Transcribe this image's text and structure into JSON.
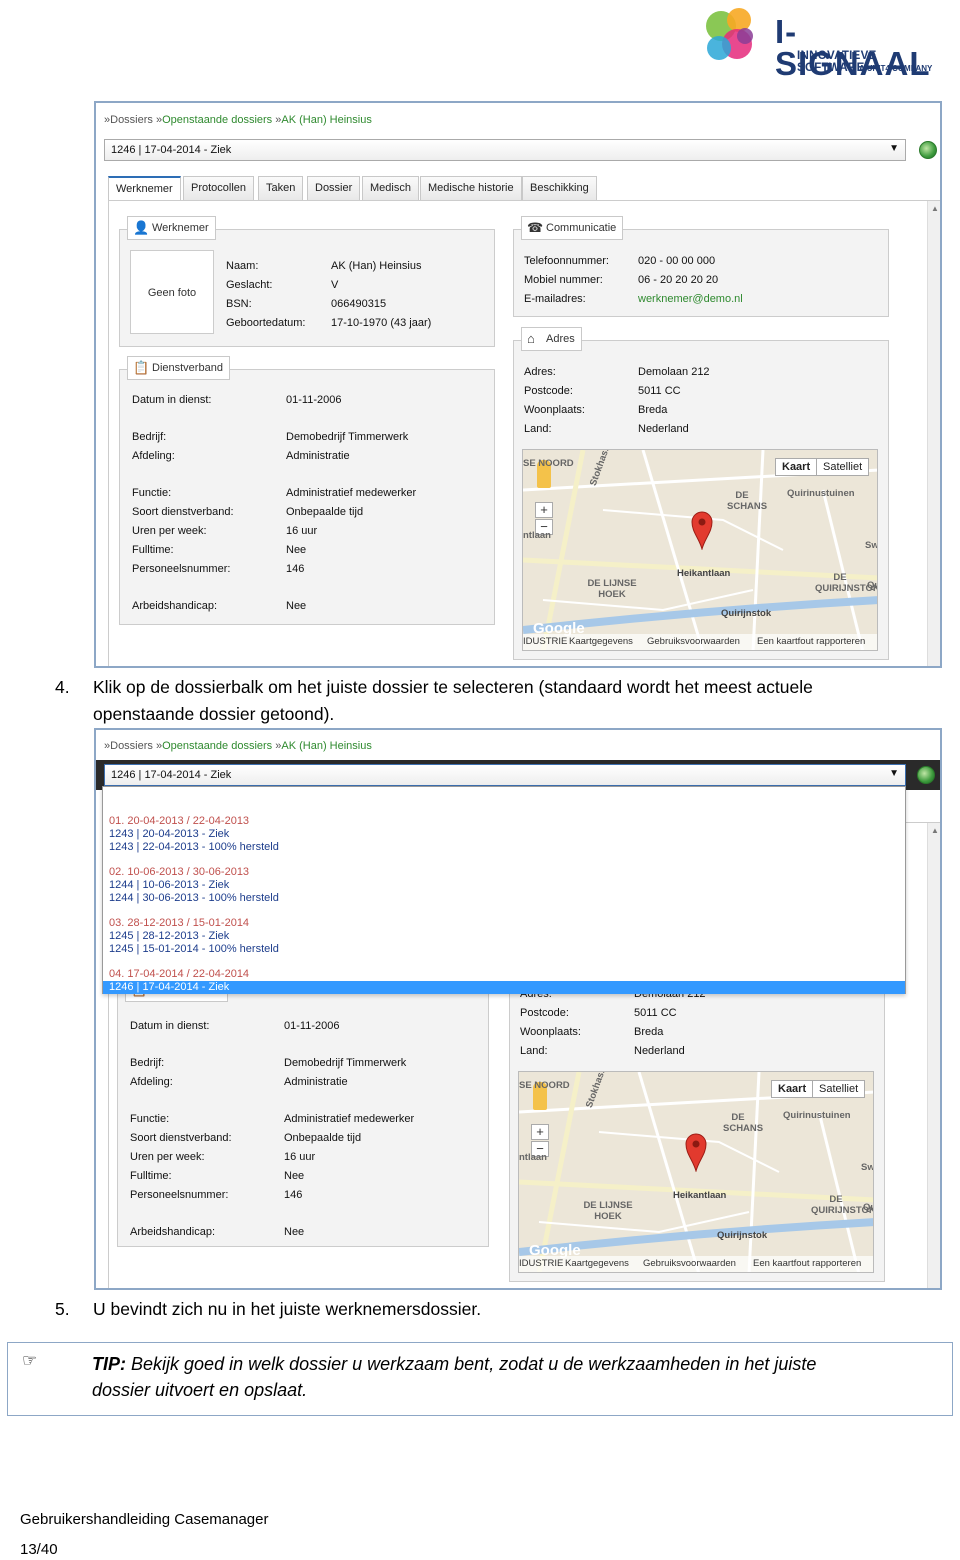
{
  "logo": {
    "name": "I-SIGNAAL",
    "tagline": "INNOVATIEVE SOFTWARE",
    "company": "A UNIT4 COMPANY"
  },
  "app": {
    "breadcrumb": [
      "Dossiers",
      "Openstaande dossiers",
      "AK (Han) Heinsius"
    ],
    "breadcrumb_sep": "»",
    "dossier_select": "1246 | 17-04-2014 - Ziek",
    "tabs": [
      "Werknemer",
      "Protocollen",
      "Taken",
      "Dossier",
      "Medisch",
      "Medische historie",
      "Beschikking"
    ],
    "werknemer": {
      "title": "Werknemer",
      "photo": "Geen foto",
      "labels": [
        "Naam:",
        "Geslacht:",
        "BSN:",
        "Geboortedatum:"
      ],
      "values": [
        "AK (Han) Heinsius",
        "V",
        "066490315",
        "17-10-1970 (43 jaar)"
      ]
    },
    "communicatie": {
      "title": "Communicatie",
      "labels": [
        "Telefoonnummer:",
        "Mobiel nummer:",
        "E-mailadres:"
      ],
      "values": [
        "020 - 00 00 000",
        "06 - 20 20 20 20",
        "werknemer@demo.nl"
      ]
    },
    "dienstverband": {
      "title": "Dienstverband",
      "labels": [
        "Datum in dienst:",
        "Bedrijf:",
        "Afdeling:",
        "Functie:",
        "Soort dienstverband:",
        "Uren per week:",
        "Fulltime:",
        "Personeelsnummer:",
        "Arbeidshandicap:"
      ],
      "values": [
        "01-11-2006",
        "Demobedrijf Timmerwerk",
        "Administratie",
        "Administratief medewerker",
        "Onbepaalde tijd",
        "16 uur",
        "Nee",
        "146",
        "Nee"
      ]
    },
    "adres": {
      "title": "Adres",
      "labels": [
        "Adres:",
        "Postcode:",
        "Woonplaats:",
        "Land:"
      ],
      "values": [
        "Demolaan 212",
        "5011 CC",
        "Breda",
        "Nederland"
      ]
    },
    "map": {
      "buttons": [
        "Kaart",
        "Satelliet"
      ],
      "zoom": [
        "+",
        "−"
      ],
      "labels": [
        "SE NOORD",
        "DE SCHANS",
        "Quirinustuinen",
        "Stokhasseltlaan",
        "ntlaan",
        "Heikantlaan",
        "DE LIJNSE HOEK",
        "DE QUIRIJNSTOK",
        "Quirijnstok",
        "Qu",
        "Swe"
      ],
      "logo": "Google",
      "footer": [
        "IDUSTRIE",
        "Kaartgegevens",
        "Gebruiksvoorwaarden",
        "Een kaartfout rapporteren"
      ]
    },
    "dropdown": {
      "groups": [
        {
          "title": "01. 20-04-2013 / 22-04-2013",
          "items": [
            "1243 | 20-04-2013 - Ziek",
            "1243 | 22-04-2013 - 100% hersteld"
          ]
        },
        {
          "title": "02. 10-06-2013 / 30-06-2013",
          "items": [
            "1244 | 10-06-2013 - Ziek",
            "1244 | 30-06-2013 - 100% hersteld"
          ]
        },
        {
          "title": "03. 28-12-2013 / 15-01-2014",
          "items": [
            "1245 | 28-12-2013 - Ziek",
            "1245 | 15-01-2014 - 100% hersteld"
          ]
        },
        {
          "title": "04. 17-04-2014 / 22-04-2014",
          "items": []
        }
      ],
      "selected": "1246 | 17-04-2014 - Ziek"
    }
  },
  "doc": {
    "step4_num": "4.",
    "step4_line1": "Klik op de dossierbalk om het juiste dossier te selecteren (standaard wordt het meest actuele",
    "step4_line2": "openstaande dossier getoond).",
    "step5_num": "5.",
    "step5_text": "U bevindt zich nu in het juiste werknemersdossier.",
    "tip_icon": "☞",
    "tip_label": "TIP:",
    "tip_line1": "Bekijk goed in welk dossier u werkzaam bent, zodat u de werkzaamheden in het juiste",
    "tip_line2": "dossier uitvoert en opslaat.",
    "footer_title": "Gebruikershandleiding Casemanager",
    "page": "13/40"
  }
}
